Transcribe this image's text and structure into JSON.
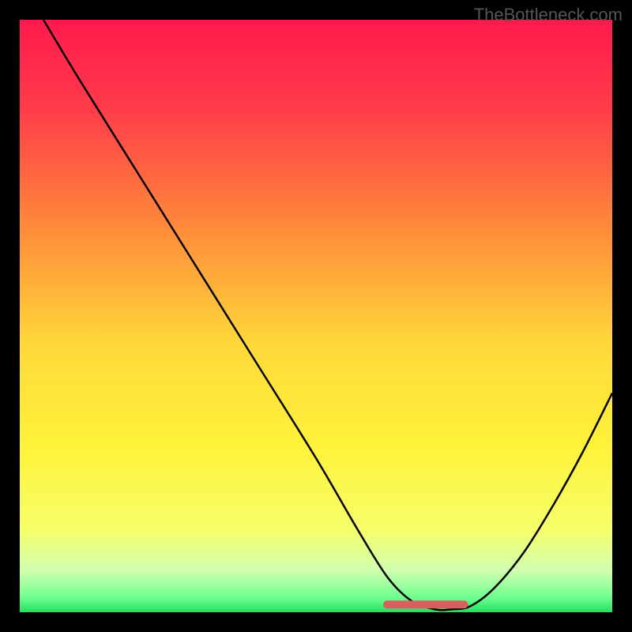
{
  "watermark": "TheBottleneck.com",
  "chart_data": {
    "type": "line",
    "title": "",
    "xlabel": "",
    "ylabel": "",
    "xlim": [
      0,
      100
    ],
    "ylim": [
      0,
      100
    ],
    "series": [
      {
        "name": "bottleneck-curve",
        "x": [
          4,
          10,
          20,
          30,
          40,
          50,
          57,
          62,
          66,
          70,
          73,
          76,
          80,
          85,
          90,
          95,
          100
        ],
        "y": [
          100,
          90,
          74,
          58,
          42,
          26,
          14,
          6,
          2,
          0.5,
          0.5,
          1,
          4,
          10,
          18,
          27,
          37
        ]
      }
    ],
    "annotations": [
      {
        "name": "optimal-zone",
        "type": "segment",
        "x0": 62,
        "y0": 1.3,
        "x1": 75,
        "y1": 1.3,
        "color": "#d95f5f",
        "width": 10
      }
    ],
    "background": {
      "type": "vertical-gradient",
      "stops": [
        {
          "offset": 0.0,
          "color": "#ff1a4d"
        },
        {
          "offset": 0.15,
          "color": "#ff3b4a"
        },
        {
          "offset": 0.35,
          "color": "#ff8a3a"
        },
        {
          "offset": 0.55,
          "color": "#ffd93a"
        },
        {
          "offset": 0.72,
          "color": "#fff23a"
        },
        {
          "offset": 0.86,
          "color": "#f6ff6a"
        },
        {
          "offset": 0.93,
          "color": "#d0ffb0"
        },
        {
          "offset": 0.975,
          "color": "#70ff90"
        },
        {
          "offset": 1.0,
          "color": "#20e060"
        }
      ]
    }
  }
}
